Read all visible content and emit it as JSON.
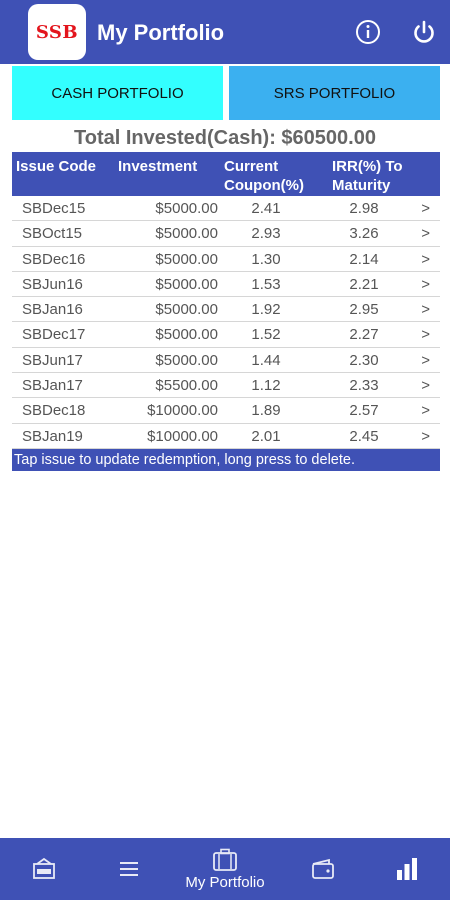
{
  "header": {
    "logo_text": "SSB",
    "title": "My Portfolio",
    "info_icon": "info-icon",
    "power_icon": "power-icon"
  },
  "tabs": [
    {
      "label": "CASH PORTFOLIO",
      "selected": true
    },
    {
      "label": "SRS PORTFOLIO",
      "selected": false
    }
  ],
  "summary": {
    "total_invested": "Total Invested(Cash): $60500.00"
  },
  "table": {
    "headers": {
      "code": "Issue Code",
      "investment": "Investment",
      "coupon_line1": "Current",
      "coupon_line2": "Coupon(%)",
      "irr_line1": "IRR(%) To",
      "irr_line2": "Maturity"
    },
    "rows": [
      {
        "code": "SBDec15",
        "investment": "$5000.00",
        "coupon": "2.41",
        "irr": "2.98",
        "arrow": ">"
      },
      {
        "code": "SBOct15",
        "investment": "$5000.00",
        "coupon": "2.93",
        "irr": "3.26",
        "arrow": ">"
      },
      {
        "code": "SBDec16",
        "investment": "$5000.00",
        "coupon": "1.30",
        "irr": "2.14",
        "arrow": ">"
      },
      {
        "code": "SBJun16",
        "investment": "$5000.00",
        "coupon": "1.53",
        "irr": "2.21",
        "arrow": ">"
      },
      {
        "code": "SBJan16",
        "investment": "$5000.00",
        "coupon": "1.92",
        "irr": "2.95",
        "arrow": ">"
      },
      {
        "code": "SBDec17",
        "investment": "$5000.00",
        "coupon": "1.52",
        "irr": "2.27",
        "arrow": ">"
      },
      {
        "code": "SBJun17",
        "investment": "$5000.00",
        "coupon": "1.44",
        "irr": "2.30",
        "arrow": ">"
      },
      {
        "code": "SBJan17",
        "investment": "$5500.00",
        "coupon": "1.12",
        "irr": "2.33",
        "arrow": ">"
      },
      {
        "code": "SBDec18",
        "investment": "$10000.00",
        "coupon": "1.89",
        "irr": "2.57",
        "arrow": ">"
      },
      {
        "code": "SBJan19",
        "investment": "$10000.00",
        "coupon": "2.01",
        "irr": "2.45",
        "arrow": ">"
      }
    ],
    "hint": "Tap issue to update redemption, long press to delete."
  },
  "bottom_nav": {
    "items": [
      {
        "icon": "new-issue-icon",
        "label": ""
      },
      {
        "icon": "menu-list-icon",
        "label": ""
      },
      {
        "icon": "briefcase-icon",
        "label": "My Portfolio",
        "active": true
      },
      {
        "icon": "wallet-icon",
        "label": ""
      },
      {
        "icon": "bar-chart-icon",
        "label": ""
      }
    ]
  },
  "colors": {
    "primary": "#3f51b5",
    "tab_cash": "#33ffff",
    "tab_srs": "#3bb0f0",
    "logo_red": "#e3141c"
  }
}
